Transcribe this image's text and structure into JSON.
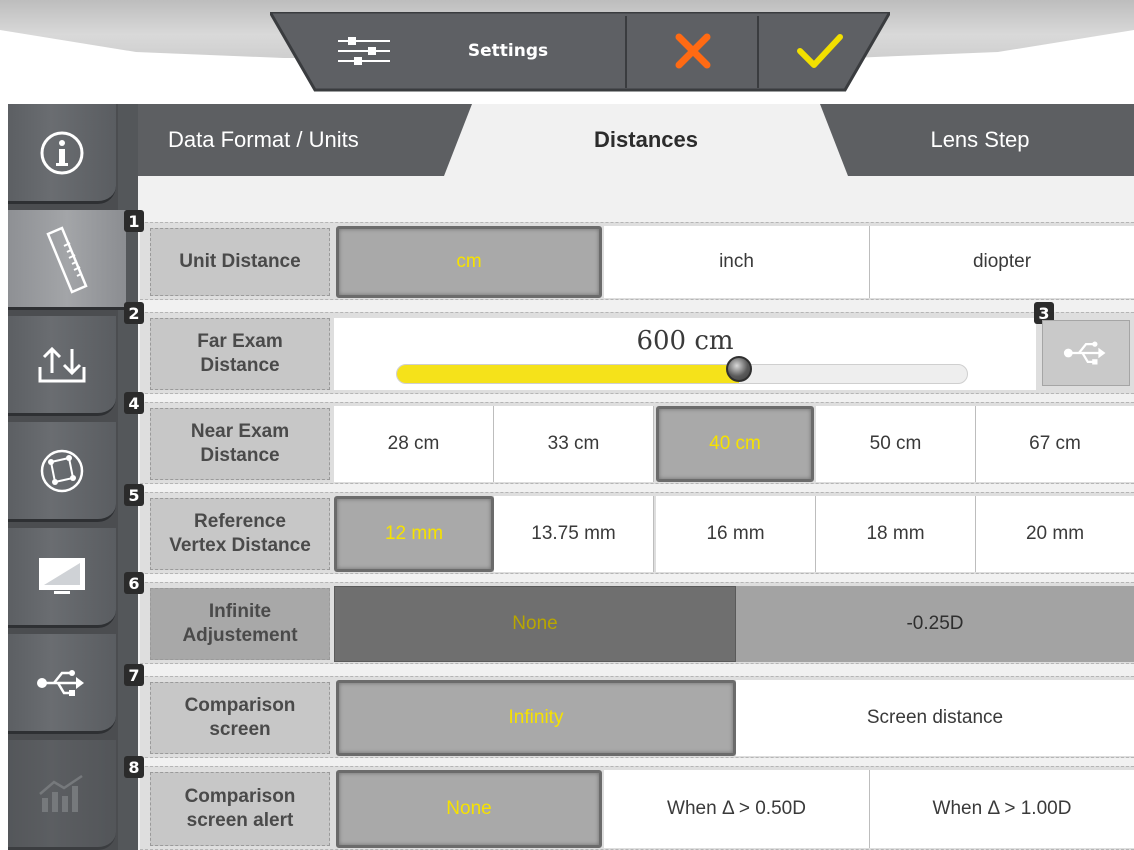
{
  "toolbar": {
    "title": "Settings",
    "icons": {
      "settings": "sliders-icon",
      "cancel": "x-icon",
      "confirm": "check-icon"
    },
    "colors": {
      "cancel": "#ff6a13",
      "confirm": "#f2e000"
    }
  },
  "nav": {
    "items": [
      {
        "icon": "info-icon",
        "active": false
      },
      {
        "icon": "ruler-icon",
        "active": true
      },
      {
        "icon": "import-export-icon",
        "active": false
      },
      {
        "icon": "globe-network-icon",
        "active": false
      },
      {
        "icon": "monitor-icon",
        "active": false
      },
      {
        "icon": "usb-icon",
        "active": false
      },
      {
        "icon": "chart-icon",
        "active": false
      }
    ]
  },
  "tabs": [
    {
      "label": "Data Format / Units",
      "active": false
    },
    {
      "label": "Distances",
      "active": true
    },
    {
      "label": "Lens Step",
      "active": false
    }
  ],
  "rows": {
    "unit_distance": {
      "badge": "1",
      "label": "Unit Distance",
      "options": [
        "cm",
        "inch",
        "diopter"
      ],
      "selected": "cm"
    },
    "far_exam": {
      "badge": "2",
      "label_line1": "Far Exam",
      "label_line2": "Distance",
      "value": "600 cm",
      "slider_fraction": 0.6
    },
    "usb": {
      "badge": "3"
    },
    "near_exam": {
      "badge": "4",
      "label_line1": "Near Exam",
      "label_line2": "Distance",
      "options": [
        "28 cm",
        "33 cm",
        "40 cm",
        "50 cm",
        "67 cm"
      ],
      "selected": "40 cm"
    },
    "vertex": {
      "badge": "5",
      "label_line1": "Reference",
      "label_line2": "Vertex Distance",
      "options": [
        "12 mm",
        "13.75 mm",
        "16 mm",
        "18 mm",
        "20 mm"
      ],
      "selected": "12 mm"
    },
    "infinite": {
      "badge": "6",
      "label_line1": "Infinite",
      "label_line2": "Adjustement",
      "options": [
        "None",
        "-0.25D"
      ],
      "selected": "None"
    },
    "comparison": {
      "badge": "7",
      "label_line1": "Comparison",
      "label_line2": "screen",
      "options": [
        "Infinity",
        "Screen distance"
      ],
      "selected": "Infinity"
    },
    "alert": {
      "badge": "8",
      "label_line1": "Comparison",
      "label_line2": "screen alert",
      "options": [
        "None",
        "When Δ > 0.50D",
        "When Δ > 1.00D"
      ],
      "selected": "None"
    }
  }
}
